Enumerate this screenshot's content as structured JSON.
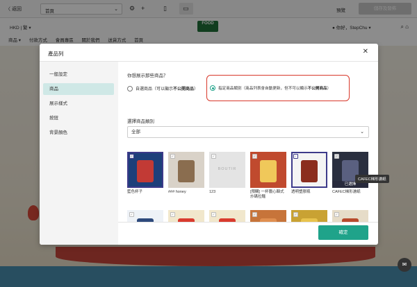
{
  "toolbar": {
    "back_label": "〈 返回",
    "page_select": "首頁",
    "gear_glyph": "⚙",
    "add_glyph": "+",
    "mobile_glyph": "▯",
    "desktop_glyph": "▭",
    "preview_label": "預覽",
    "publish_label": "儲存及發佈"
  },
  "storefront": {
    "currency": "HKD | 繁 ▾",
    "logo": "FOOD",
    "user_greeting": "● 你好，StepChu ▾",
    "nav": [
      "商品 ▾",
      "付款方式",
      "會員專區",
      "關於我們",
      "送貨方式",
      "首頁"
    ],
    "icons": "⌕  ⌂"
  },
  "modal": {
    "title": "產品列",
    "close_glyph": "✕",
    "sidebar": [
      "一般設定",
      "商品",
      "展示樣式",
      "按鈕",
      "背景顏色"
    ],
    "active_index": 1,
    "question": "你想展示那些商品？",
    "option_custom": {
      "text": "自選商品（可以顯示",
      "bold": "不公開商品",
      "tail": "）"
    },
    "option_category": {
      "text": "指定商品類別（商品列表會自動更新，但不可以顯示",
      "bold": "不公開商品",
      "tail": "）"
    },
    "selected_option": "category",
    "category_label": "選擇商品類別",
    "category_value": "全部",
    "products": [
      {
        "name": "藍色杯子",
        "selected": true,
        "bg": "#1d3f7a",
        "accent": "#c23a35"
      },
      {
        "name": "### honey",
        "selected": false,
        "bg": "#d9d2c8",
        "accent": "#8a6d4f"
      },
      {
        "name": "123",
        "selected": false,
        "bg": "#e4e4e4",
        "accent": "#bdbdbd",
        "placeholder": "BOUTIR"
      },
      {
        "name": "[預購] 一杯農心韓式炒碼拉麵",
        "selected": false,
        "bg": "#c04a2e",
        "accent": "#f0c85a"
      },
      {
        "name": "透明塑膠瓶",
        "selected": true,
        "bg": "#f4f4f4",
        "accent": "#8b2d1e"
      },
      {
        "name": "CAFEC梯形濾紙",
        "selected": false,
        "bg": "#2a2f3f",
        "accent": "#5a6080",
        "badge": "已選擇"
      },
      {
        "name": "",
        "selected": false,
        "bg": "#eef2f7",
        "accent": "#2e4a7c"
      },
      {
        "name": "",
        "selected": false,
        "bg": "#f1e7cc",
        "accent": "#d93b2e"
      },
      {
        "name": "",
        "selected": false,
        "bg": "#f1e7cc",
        "accent": "#d93b2e"
      },
      {
        "name": "",
        "selected": false,
        "bg": "#c7743a",
        "accent": "#e08f50"
      },
      {
        "name": "",
        "selected": false,
        "bg": "#c9a233",
        "accent": "#e8c34d"
      },
      {
        "name": "",
        "selected": false,
        "bg": "#e6dcc8",
        "accent": "#b74a2c"
      }
    ],
    "tooltip": "CAFEC梯形濾紙",
    "confirm_label": "確定"
  },
  "chat_glyph": "✉"
}
